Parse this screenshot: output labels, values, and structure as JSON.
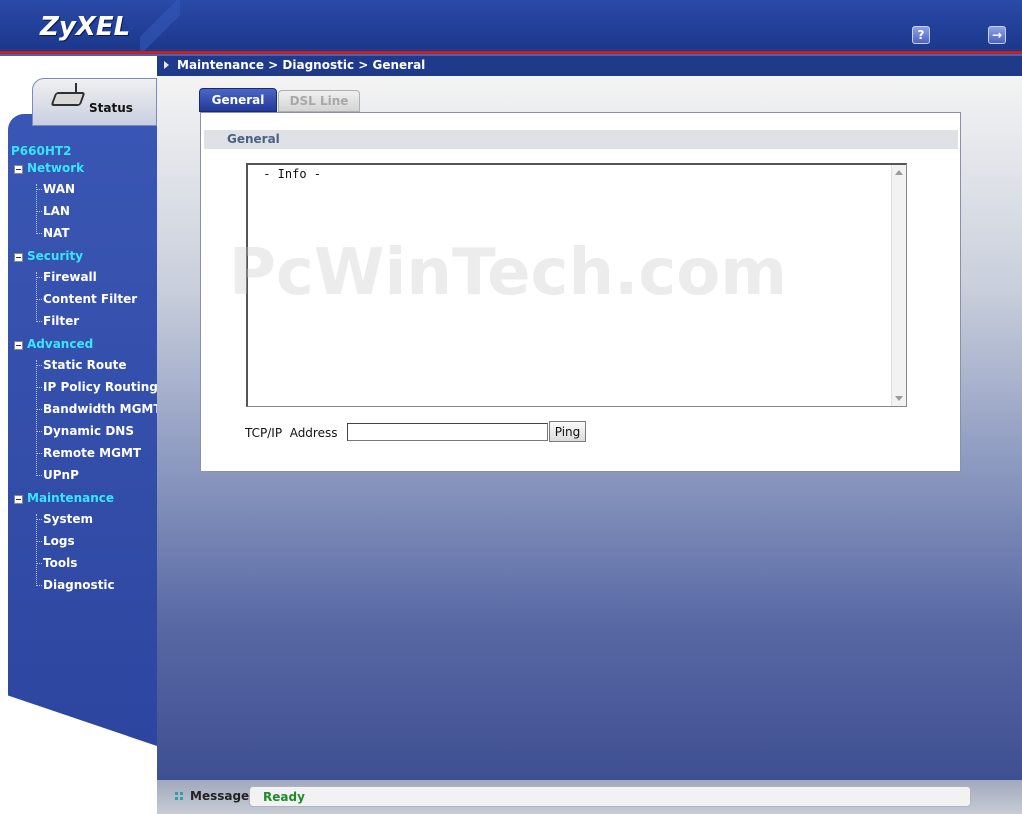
{
  "header": {
    "logo": "ZyXEL",
    "help_icon": "help-icon",
    "logout_icon": "logout-icon"
  },
  "sidebar": {
    "status_tab": "Status",
    "device_name": "P660HT2",
    "groups": [
      {
        "label": "Network",
        "items": [
          "WAN",
          "LAN",
          "NAT"
        ]
      },
      {
        "label": "Security",
        "items": [
          "Firewall",
          "Content Filter",
          "Filter"
        ]
      },
      {
        "label": "Advanced",
        "items": [
          "Static Route",
          "IP Policy Routing",
          "Bandwidth MGMT",
          "Dynamic DNS",
          "Remote MGMT",
          "UPnP"
        ]
      },
      {
        "label": "Maintenance",
        "items": [
          "System",
          "Logs",
          "Tools",
          "Diagnostic"
        ]
      }
    ]
  },
  "breadcrumb": "Maintenance > Diagnostic > General",
  "tabs": {
    "general": "General",
    "dsl": "DSL Line"
  },
  "panel": {
    "heading": "General",
    "info_text": " - Info -",
    "tcpip_label": "TCP/IP  Address",
    "tcpip_value": "",
    "ping_label": "Ping"
  },
  "watermark": "PcWinTech.com",
  "statusbar": {
    "label": "Message",
    "value": "Ready"
  },
  "colors": {
    "accent": "#1f3a8a",
    "nav_group": "#38e6ff",
    "status_ok": "#1e8c2a",
    "header_red": "#c42020"
  }
}
